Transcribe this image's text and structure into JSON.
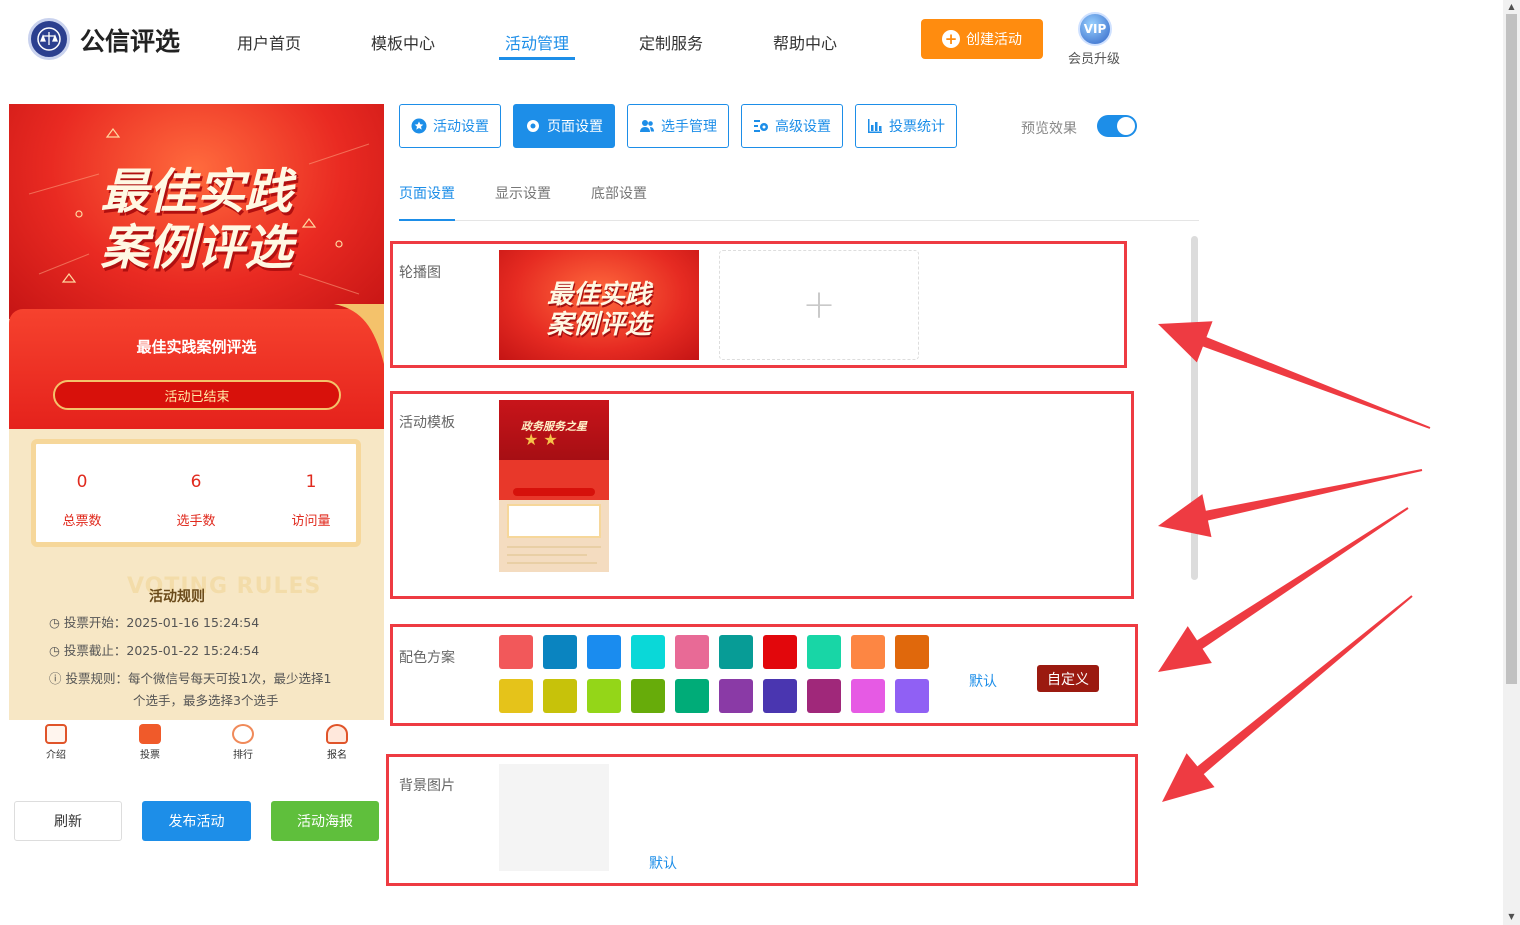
{
  "header": {
    "logo_text": "公信评选",
    "nav": [
      "用户首页",
      "模板中心",
      "活动管理",
      "定制服务",
      "帮助中心"
    ],
    "active_nav": "活动管理",
    "create_button": "创建活动",
    "vip_badge": "VIP",
    "vip_label": "会员升级"
  },
  "preview": {
    "banner_line1": "最佳实践",
    "banner_line2": "案例评选",
    "activity_name": "最佳实践案例评选",
    "status": "活动已结束",
    "stats": [
      {
        "value": "0",
        "label": "总票数"
      },
      {
        "value": "6",
        "label": "选手数"
      },
      {
        "value": "1",
        "label": "访问量"
      }
    ],
    "rules_bg": "VOTING RULES",
    "rules_title": "活动规则",
    "rules": [
      "投票开始：2025-01-16 15:24:54",
      "投票截止：2025-01-22 15:24:54",
      "投票规则：每个微信号每天可投1次，最少选择1",
      "个选手，最多选择3个选手"
    ],
    "tabbar": [
      "介绍",
      "投票",
      "排行",
      "报名"
    ]
  },
  "actions": {
    "refresh": "刷新",
    "publish": "发布活动",
    "poster": "活动海报"
  },
  "settings_tabs": [
    "活动设置",
    "页面设置",
    "选手管理",
    "高级设置",
    "投票统计"
  ],
  "active_settings_tab": "页面设置",
  "preview_toggle_label": "预览效果",
  "preview_toggle_on": true,
  "sub_tabs": [
    "页面设置",
    "显示设置",
    "底部设置"
  ],
  "active_sub_tab": "页面设置",
  "sections": {
    "carousel_label": "轮播图",
    "carousel_thumb_line1": "最佳实践",
    "carousel_thumb_line2": "案例评选",
    "upload_plus": "+",
    "template_label": "活动模板",
    "template_thumb_title": "政务服务之星",
    "color_label": "配色方案",
    "color_default": "默认",
    "color_custom": "自定义",
    "bg_label": "背景图片",
    "bg_default": "默认"
  },
  "color_swatches": [
    "#f2585a",
    "#0a84c0",
    "#1a8cef",
    "#0ad8d8",
    "#e86a96",
    "#079c96",
    "#e2070c",
    "#18d6a6",
    "#fd8643",
    "#e0680c",
    "#e5c31a",
    "#c7c20a",
    "#94d618",
    "#67ac0a",
    "#00ac78",
    "#8a3aa6",
    "#4a36b0",
    "#a0287a",
    "#e65ae4",
    "#9060f4"
  ],
  "arrow_color": "#ee3b42",
  "accent_color": "#1d8ee8"
}
